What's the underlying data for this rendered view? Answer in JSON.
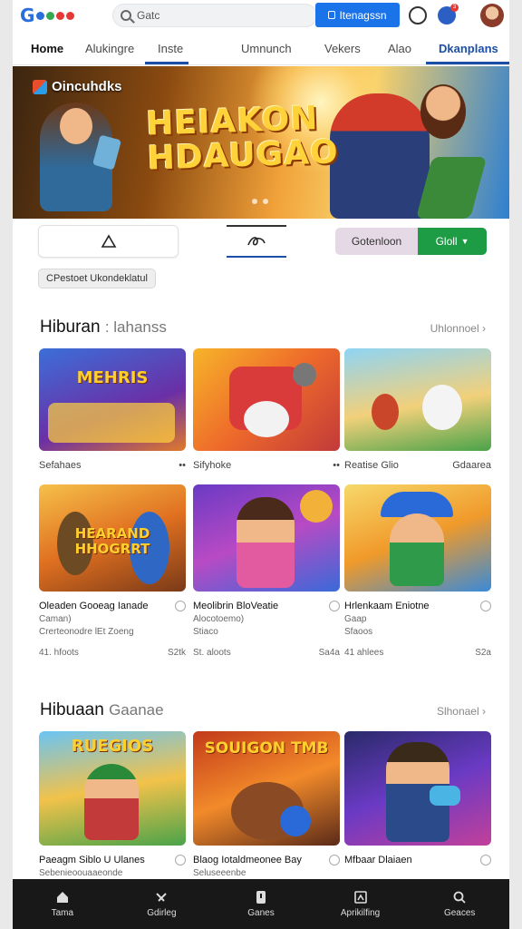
{
  "topbar": {
    "logo_letter": "G",
    "search_value": "Gatc",
    "signin_label": "Itenagssn",
    "notification_count": "3"
  },
  "nav": {
    "tabs": [
      {
        "label": "Home"
      },
      {
        "label": "Alukingre"
      },
      {
        "label": "Inste"
      },
      {
        "label": "Umnunch"
      },
      {
        "label": "Vekers"
      },
      {
        "label": "Alao"
      },
      {
        "label": "Dkanplans"
      }
    ]
  },
  "hero": {
    "brand": "Oincuhdks",
    "title_line1": "HEIAKON",
    "title_line2": "HDAUGAO"
  },
  "actions": {
    "segment_left": "Gotenloon",
    "segment_right": "Gloll"
  },
  "chip": "CPestoet Ukondeklatul",
  "section1": {
    "title": "Hiburan",
    "subtitle": ": lahanss",
    "see_more": "Uhlonnoel",
    "row1": [
      {
        "thumb_text": "MEHRIS",
        "caption_left": "Sefahaes",
        "caption_right": "••"
      },
      {
        "thumb_text": "",
        "caption_left": "Sifyhoke",
        "caption_right": "••"
      },
      {
        "thumb_text": "",
        "caption_left": "Reatise Glio",
        "caption_right": "Gdaarea"
      }
    ],
    "row2": [
      {
        "thumb_text": "HEARAND HHOGRRT",
        "title": "Oleaden Gooeag Ianade",
        "title2": "Caman)",
        "sub": "Crerteonodre lEt Zoeng",
        "meta_left": "41. hfoots",
        "meta_right": "S2tk"
      },
      {
        "thumb_text": "",
        "title": "Meolibrin BloVeatie",
        "title2": "",
        "sub": "Alocotoemo)",
        "sub2": "Stiaco",
        "meta_left": "St. aloots",
        "meta_right": "Sa4a"
      },
      {
        "thumb_text": "",
        "title": "Hrlenkaam Eniotne",
        "title2": "Gaap",
        "sub": "Sfaoos",
        "meta_left": "41 ahlees",
        "meta_right": "S2a"
      }
    ]
  },
  "section2": {
    "title": "Hibuaan",
    "subtitle": "Gaanae",
    "see_more": "Slhonael",
    "cards": [
      {
        "thumb_text": "RUEGIOS",
        "title": "Paeagm Siblo U Ulanes",
        "sub": "Sebenieoouaaeonde"
      },
      {
        "thumb_text": "SOUIGON TMB",
        "title": "Blaog Iotaldmeonee Bay",
        "sub": "Seluseeenbe"
      },
      {
        "thumb_text": "",
        "title": "Mfbaar Dlaiaen",
        "sub": ""
      }
    ]
  },
  "bottomnav": [
    {
      "label": "Tama",
      "icon": "home-icon"
    },
    {
      "label": "Gdirleg",
      "icon": "games-icon"
    },
    {
      "label": "Ganes",
      "icon": "apps-icon"
    },
    {
      "label": "Aprikilfing",
      "icon": "library-icon"
    },
    {
      "label": "Geaces",
      "icon": "search-icon"
    }
  ],
  "colors": {
    "accent_blue": "#1a73e8",
    "nav_underline": "#1b4fa8",
    "segment_green": "#1e9b45",
    "bottom_bar": "#181818"
  }
}
